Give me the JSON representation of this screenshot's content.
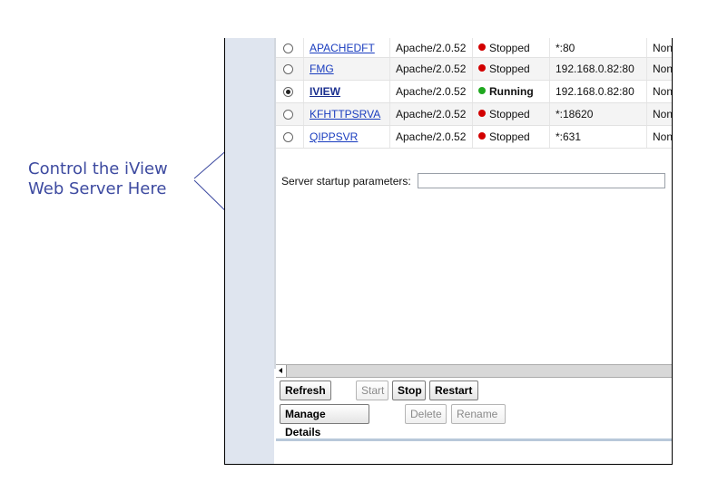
{
  "callout": {
    "line1": "Control the iView",
    "line2": "Web Server Here"
  },
  "servers": [
    {
      "selected": false,
      "name": "APACHEDFT",
      "version": "Apache/2.0.52",
      "status": "Stopped",
      "status_color": "#d20000",
      "address": "*:80",
      "auth": "None"
    },
    {
      "selected": false,
      "name": "FMG",
      "version": "Apache/2.0.52",
      "status": "Stopped",
      "status_color": "#d20000",
      "address": "192.168.0.82:80",
      "auth": "None"
    },
    {
      "selected": true,
      "name": "IVIEW",
      "version": "Apache/2.0.52",
      "status": "Running",
      "status_color": "#1fa81f",
      "address": "192.168.0.82:80",
      "auth": "None"
    },
    {
      "selected": false,
      "name": "KFHTTPSRVA",
      "version": "Apache/2.0.52",
      "status": "Stopped",
      "status_color": "#d20000",
      "address": "*:18620",
      "auth": "None"
    },
    {
      "selected": false,
      "name": "QIPPSVR",
      "version": "Apache/2.0.52",
      "status": "Stopped",
      "status_color": "#d20000",
      "address": "*:631",
      "auth": "None"
    }
  ],
  "params": {
    "label": "Server startup parameters:",
    "value": ""
  },
  "buttons": {
    "refresh": "Refresh",
    "start": "Start",
    "stop": "Stop",
    "restart": "Restart",
    "manage_details": "Manage Details",
    "delete": "Delete",
    "rename": "Rename"
  }
}
